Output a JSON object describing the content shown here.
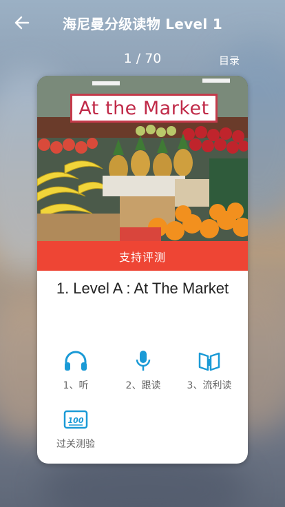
{
  "header": {
    "title": "海尼曼分级读物 Level 1",
    "back_icon": "arrow-left-icon"
  },
  "pager": {
    "indicator": "1 / 70",
    "catalog_label": "目录"
  },
  "card": {
    "cover_title": "At the Market",
    "eval_label": "支持评测",
    "book_title": "1. Level A : At The Market",
    "actions": [
      {
        "label": "1、听",
        "icon": "headphones-icon"
      },
      {
        "label": "2、跟读",
        "icon": "microphone-icon"
      },
      {
        "label": "3、流利读",
        "icon": "open-book-icon"
      },
      {
        "label": "过关测验",
        "icon": "score-100-icon"
      }
    ]
  },
  "colors": {
    "accent_blue": "#1a9ad6",
    "eval_red": "#ee4534",
    "cover_title_red": "#c02a48"
  }
}
